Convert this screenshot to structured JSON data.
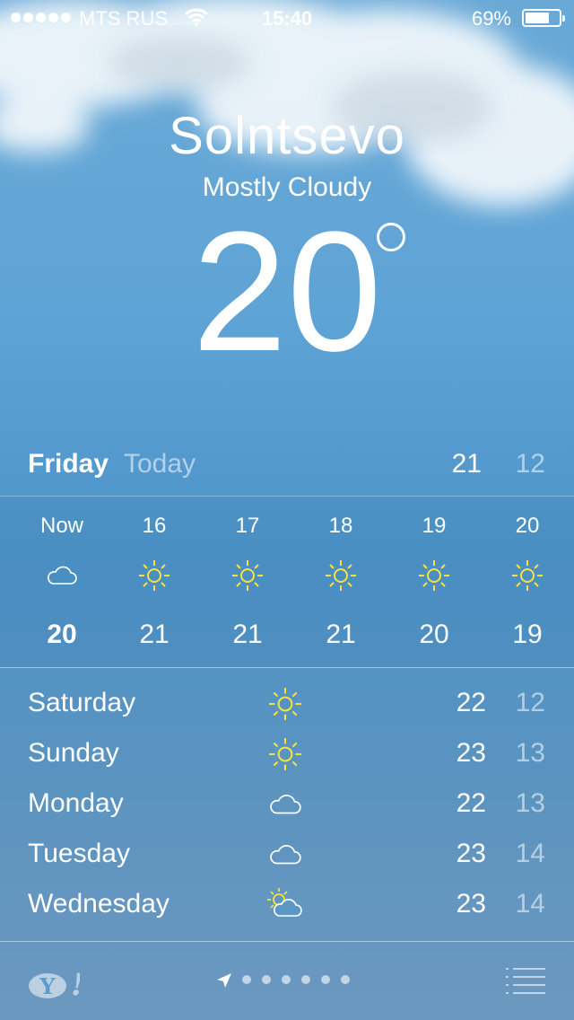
{
  "status": {
    "carrier": "MTS RUS",
    "time": "15:40",
    "battery_pct": "69%"
  },
  "location": {
    "city": "Solntsevo",
    "condition": "Mostly Cloudy",
    "temperature": "20"
  },
  "today": {
    "day": "Friday",
    "label": "Today",
    "high": "21",
    "low": "12"
  },
  "hourly": [
    {
      "label": "Now",
      "icon": "cloud-icon",
      "temp": "20"
    },
    {
      "label": "16",
      "icon": "sun-icon",
      "temp": "21"
    },
    {
      "label": "17",
      "icon": "sun-icon",
      "temp": "21"
    },
    {
      "label": "18",
      "icon": "sun-icon",
      "temp": "21"
    },
    {
      "label": "19",
      "icon": "sun-icon",
      "temp": "20"
    },
    {
      "label": "20",
      "icon": "sun-icon",
      "temp": "19"
    }
  ],
  "daily": [
    {
      "day": "Saturday",
      "icon": "sun-icon",
      "high": "22",
      "low": "12"
    },
    {
      "day": "Sunday",
      "icon": "sun-icon",
      "high": "23",
      "low": "13"
    },
    {
      "day": "Monday",
      "icon": "cloud-icon",
      "high": "22",
      "low": "13"
    },
    {
      "day": "Tuesday",
      "icon": "cloud-icon",
      "high": "23",
      "low": "14"
    },
    {
      "day": "Wednesday",
      "icon": "partly-cloudy-icon",
      "high": "23",
      "low": "14"
    }
  ],
  "footer": {
    "pages": 6,
    "current_page_icon": "location-arrow-icon"
  },
  "colors": {
    "sun": "#f5e23a",
    "sky": "#5a9fd2"
  }
}
